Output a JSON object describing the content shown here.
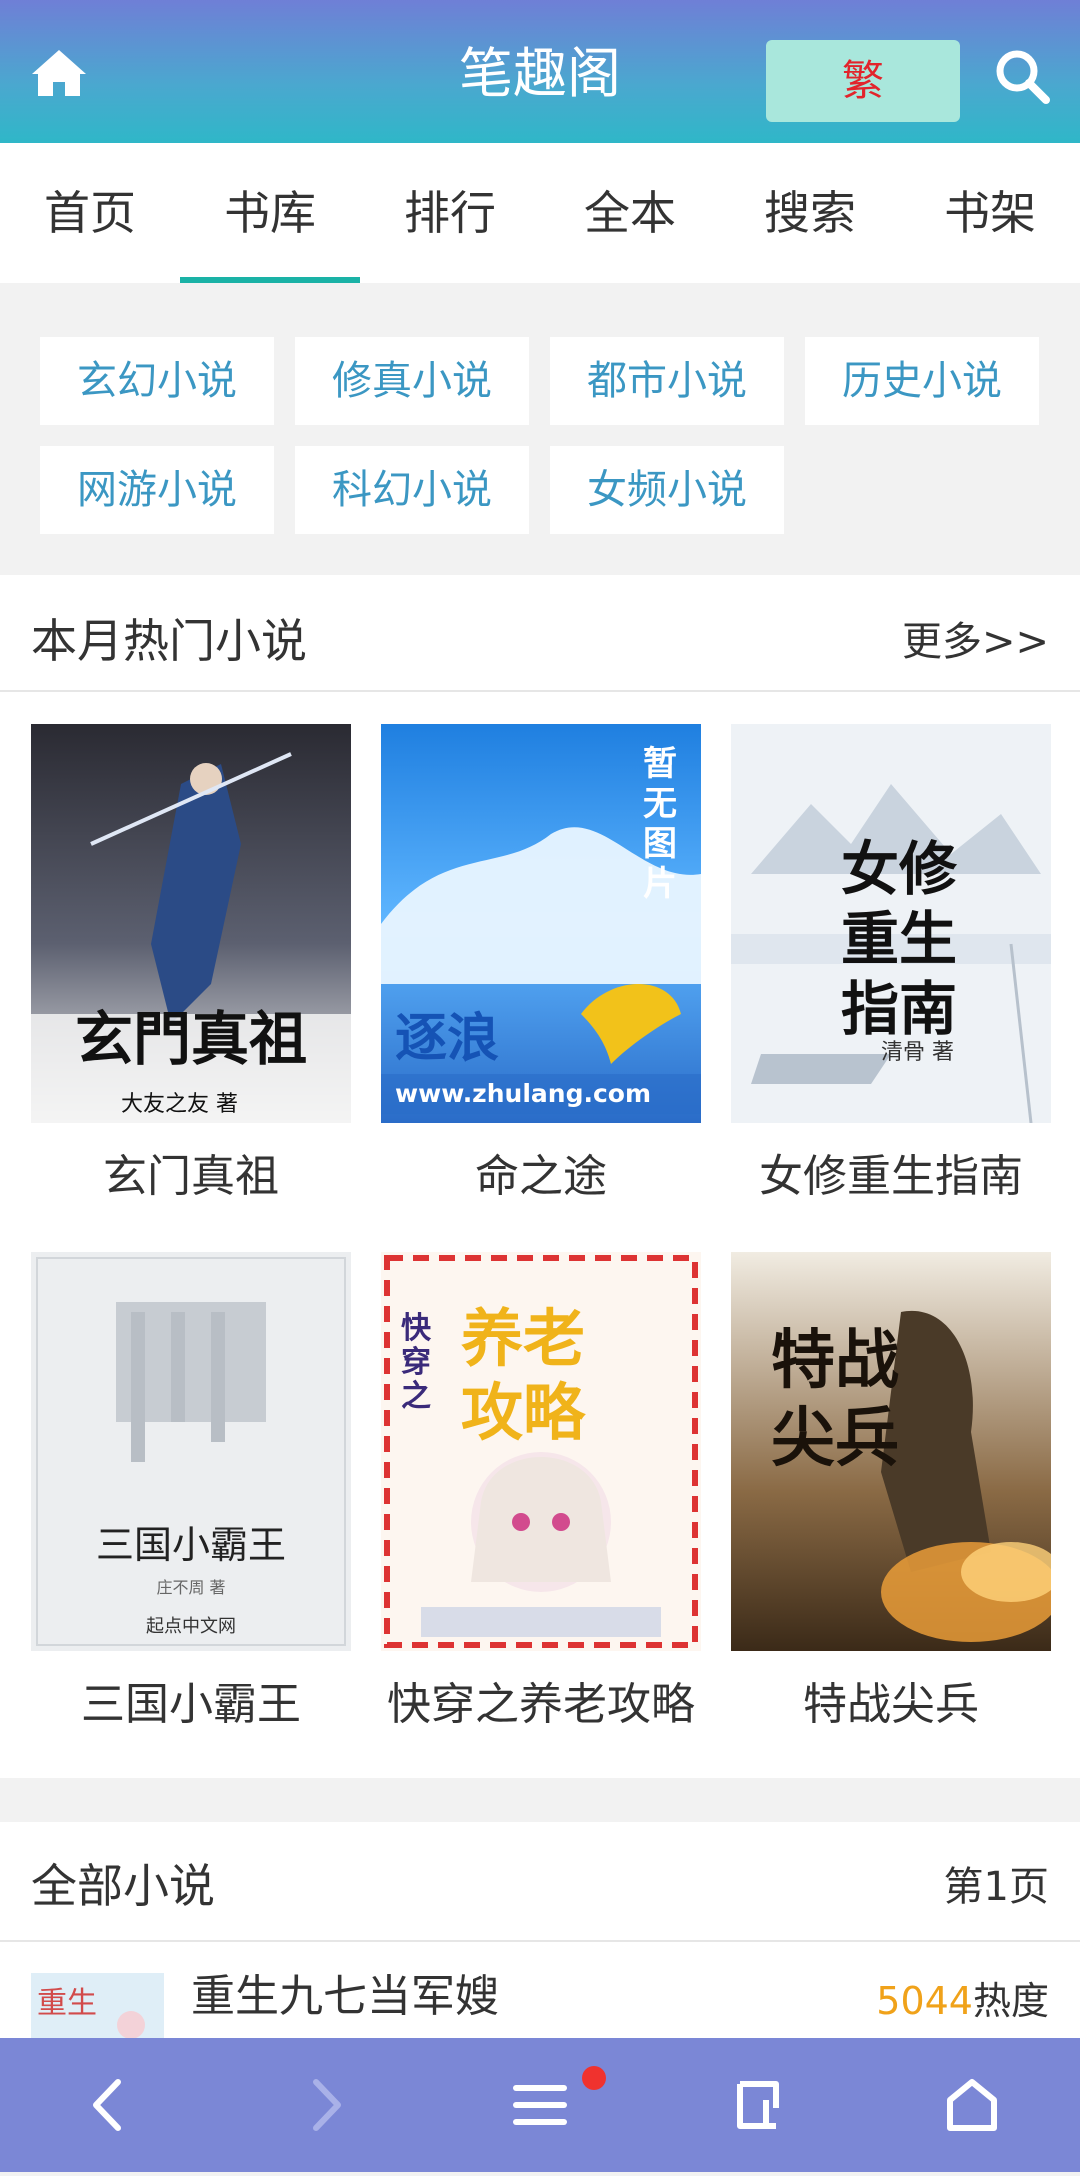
{
  "header": {
    "title": "笔趣阁",
    "traditional_label": "繁",
    "brand_color": "#4aa8cf"
  },
  "tabs": [
    {
      "label": "首页"
    },
    {
      "label": "书库",
      "active": true
    },
    {
      "label": "排行"
    },
    {
      "label": "全本"
    },
    {
      "label": "搜索"
    },
    {
      "label": "书架"
    }
  ],
  "categories": [
    {
      "label": "玄幻小说"
    },
    {
      "label": "修真小说"
    },
    {
      "label": "都市小说"
    },
    {
      "label": "历史小说"
    },
    {
      "label": "网游小说"
    },
    {
      "label": "科幻小说"
    },
    {
      "label": "女频小说"
    }
  ],
  "hot": {
    "title": "本月热门小说",
    "more": "更多>>",
    "books": [
      {
        "title": "玄门真祖",
        "cover_text": "玄門真祖",
        "cover_author": "大友之友 著"
      },
      {
        "title": "命之途",
        "cover_text": "逐浪",
        "cover_sub": "www.zhulang.com",
        "cover_note": "暂无图片"
      },
      {
        "title": "女修重生指南",
        "cover_text": "女修重生指南",
        "cover_author": "清骨 著"
      },
      {
        "title": "三国小霸王",
        "cover_text": "三国小霸王",
        "cover_author": "庄不周 著",
        "cover_publisher": "起点中文网"
      },
      {
        "title": "快穿之养老攻略",
        "cover_text": "养老攻略",
        "cover_tag": "快穿之"
      },
      {
        "title": "特战尖兵",
        "cover_text": "特战尖兵"
      }
    ]
  },
  "all": {
    "title": "全部小说",
    "page": "第1页",
    "items": [
      {
        "title": "重生九七当军嫂",
        "heat_value": "5044",
        "heat_label": "热度"
      }
    ]
  },
  "bottom_nav": {
    "icons": [
      "back-icon",
      "forward-icon",
      "menu-icon",
      "tabs-icon",
      "home-icon"
    ]
  }
}
